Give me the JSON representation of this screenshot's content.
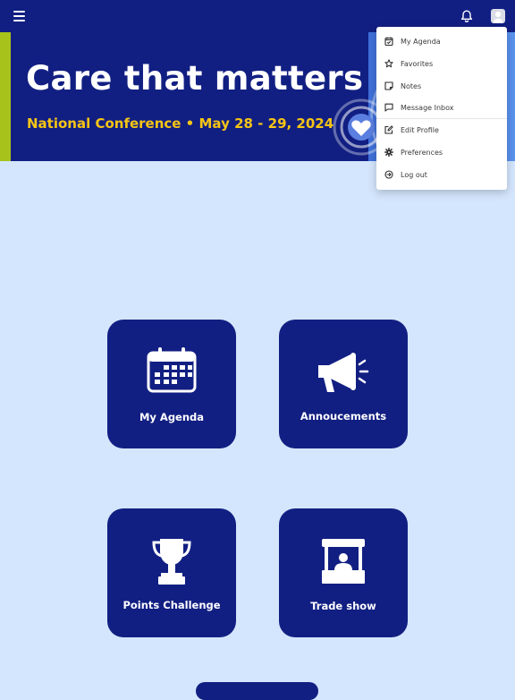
{
  "header": {
    "menu_icon": "hamburger-icon",
    "notifications_icon": "bell-icon",
    "profile_icon": "user-avatar-icon"
  },
  "hero": {
    "title": "Care that matters",
    "subtitle": "National Conference • May 28 - 29, 2024",
    "badge_icon": "heart-icon",
    "colors": {
      "background": "#121f82",
      "accent": "#a6c21b",
      "subtitle": "#f6c515"
    }
  },
  "profile_menu": {
    "items": [
      {
        "label": "My Agenda",
        "icon": "calendar-check-icon"
      },
      {
        "label": "Favorites",
        "icon": "star-icon"
      },
      {
        "label": "Notes",
        "icon": "note-icon"
      },
      {
        "label": "Message Inbox",
        "icon": "message-icon"
      },
      {
        "label": "Edit Profile",
        "icon": "edit-icon"
      },
      {
        "label": "Preferences",
        "icon": "gear-icon"
      },
      {
        "label": "Log out",
        "icon": "logout-icon"
      }
    ]
  },
  "tiles": [
    {
      "label": "My Agenda",
      "icon": "calendar-icon"
    },
    {
      "label": "Annoucements",
      "icon": "megaphone-icon"
    },
    {
      "label": "Points Challenge",
      "icon": "trophy-icon"
    },
    {
      "label": "Trade show",
      "icon": "booth-icon"
    }
  ]
}
